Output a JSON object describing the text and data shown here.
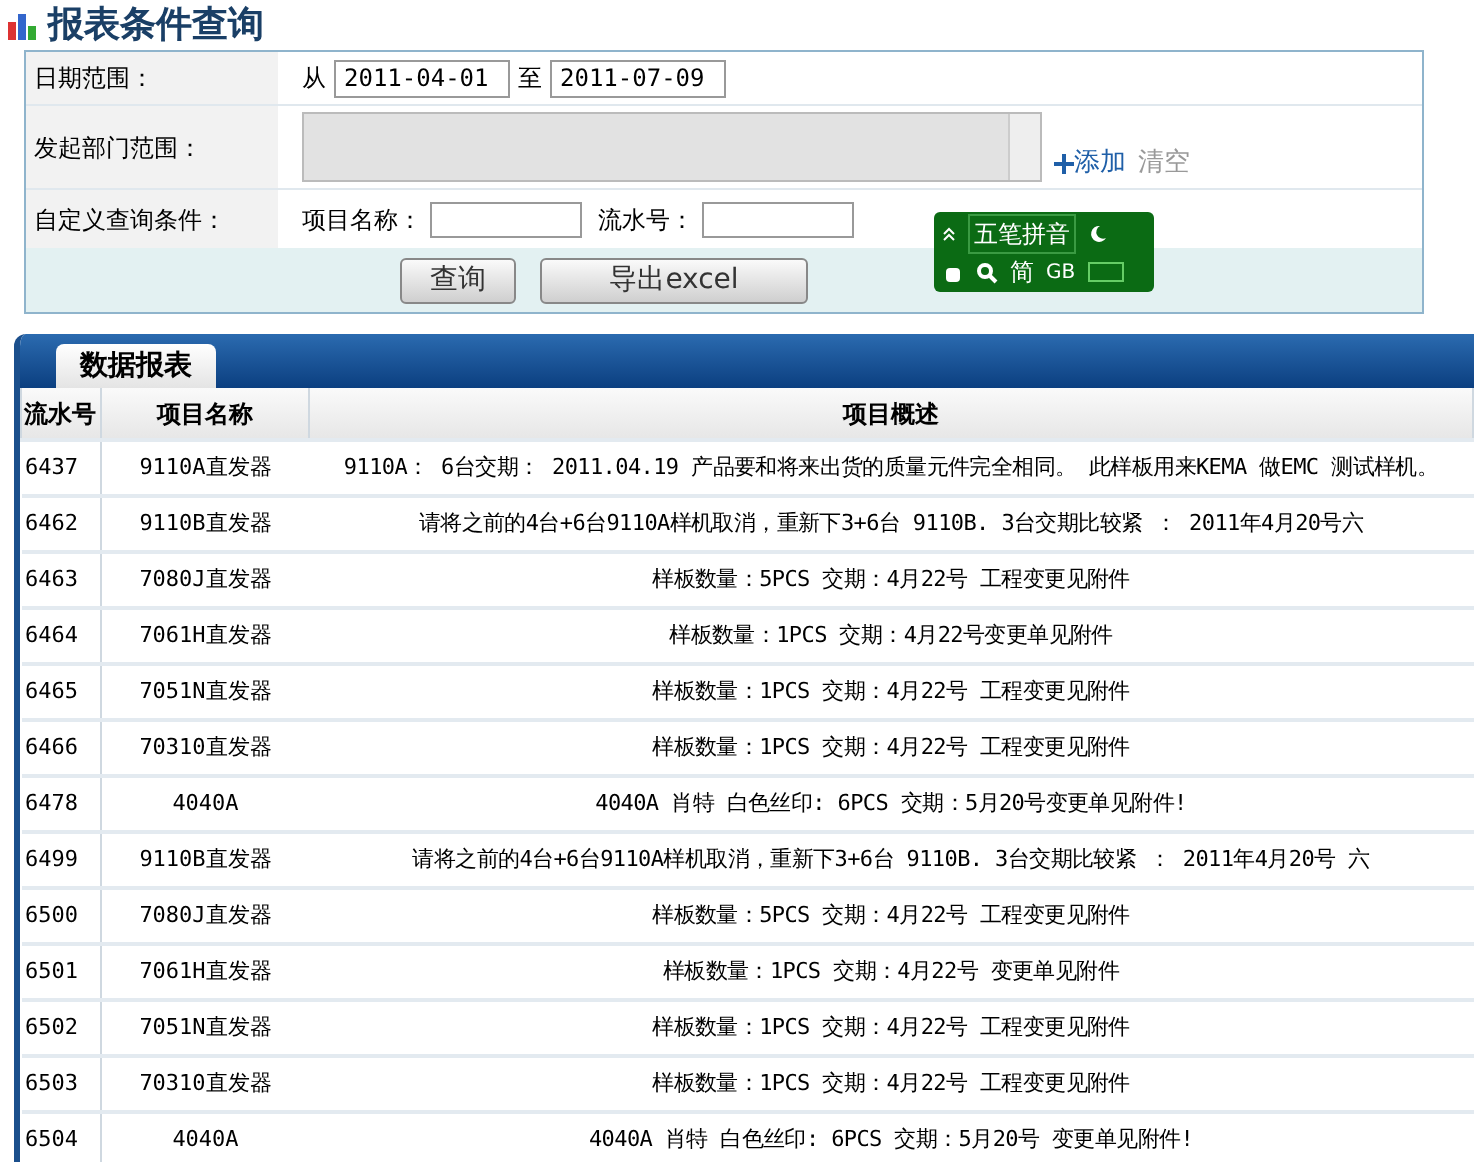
{
  "page_title": "报表条件查询",
  "form": {
    "date_range": {
      "label": "日期范围：",
      "from_label": "从",
      "from": "2011-04-01",
      "to_label": "至",
      "to": "2011-07-09"
    },
    "department": {
      "label": "发起部门范围：",
      "add_link": "添加",
      "clear_link": "清空"
    },
    "custom": {
      "label": "自定义查询条件：",
      "name_label": "项目名称：",
      "serial_label": "流水号："
    },
    "buttons": [
      "查询",
      "导出excel"
    ]
  },
  "ime_toolbar": {
    "mode": "五笔拼音",
    "charset": "简",
    "encoding": "GB"
  },
  "report": {
    "tab": "数据报表",
    "columns": [
      "流水号",
      "项目名称",
      "项目概述"
    ],
    "rows": [
      [
        "6437",
        "9110A直发器",
        "9110A： 6台交期： 2011.04.19 产品要和将来出货的质量元件完全相同。 此样板用来KEMA 做EMC 测试样机。"
      ],
      [
        "6462",
        "9110B直发器",
        "请将之前的4台+6台9110A样机取消，重新下3+6台 9110B. 3台交期比较紧 ： 2011年4月20号六"
      ],
      [
        "6463",
        "7080J直发器",
        "样板数量：5PCS 交期：4月22号 工程变更见附件"
      ],
      [
        "6464",
        "7061H直发器",
        "样板数量：1PCS 交期：4月22号变更单见附件"
      ],
      [
        "6465",
        "7051N直发器",
        "样板数量：1PCS 交期：4月22号 工程变更见附件"
      ],
      [
        "6466",
        "70310直发器",
        "样板数量：1PCS 交期：4月22号 工程变更见附件"
      ],
      [
        "6478",
        "4040A",
        "4040A 肖特 白色丝印: 6PCS 交期：5月20号变更单见附件!"
      ],
      [
        "6499",
        "9110B直发器",
        "请将之前的4台+6台9110A样机取消，重新下3+6台 9110B. 3台交期比较紧 ： 2011年4月20号 六"
      ],
      [
        "6500",
        "7080J直发器",
        "样板数量：5PCS 交期：4月22号 工程变更见附件"
      ],
      [
        "6501",
        "7061H直发器",
        "样板数量：1PCS 交期：4月22号 变更单见附件"
      ],
      [
        "6502",
        "7051N直发器",
        "样板数量：1PCS 交期：4月22号 工程变更见附件"
      ],
      [
        "6503",
        "70310直发器",
        "样板数量：1PCS 交期：4月22号 工程变更见附件"
      ],
      [
        "6504",
        "4040A",
        "4040A 肖特 白色丝印: 6PCS 交期：5月20号 变更单见附件!"
      ]
    ]
  }
}
